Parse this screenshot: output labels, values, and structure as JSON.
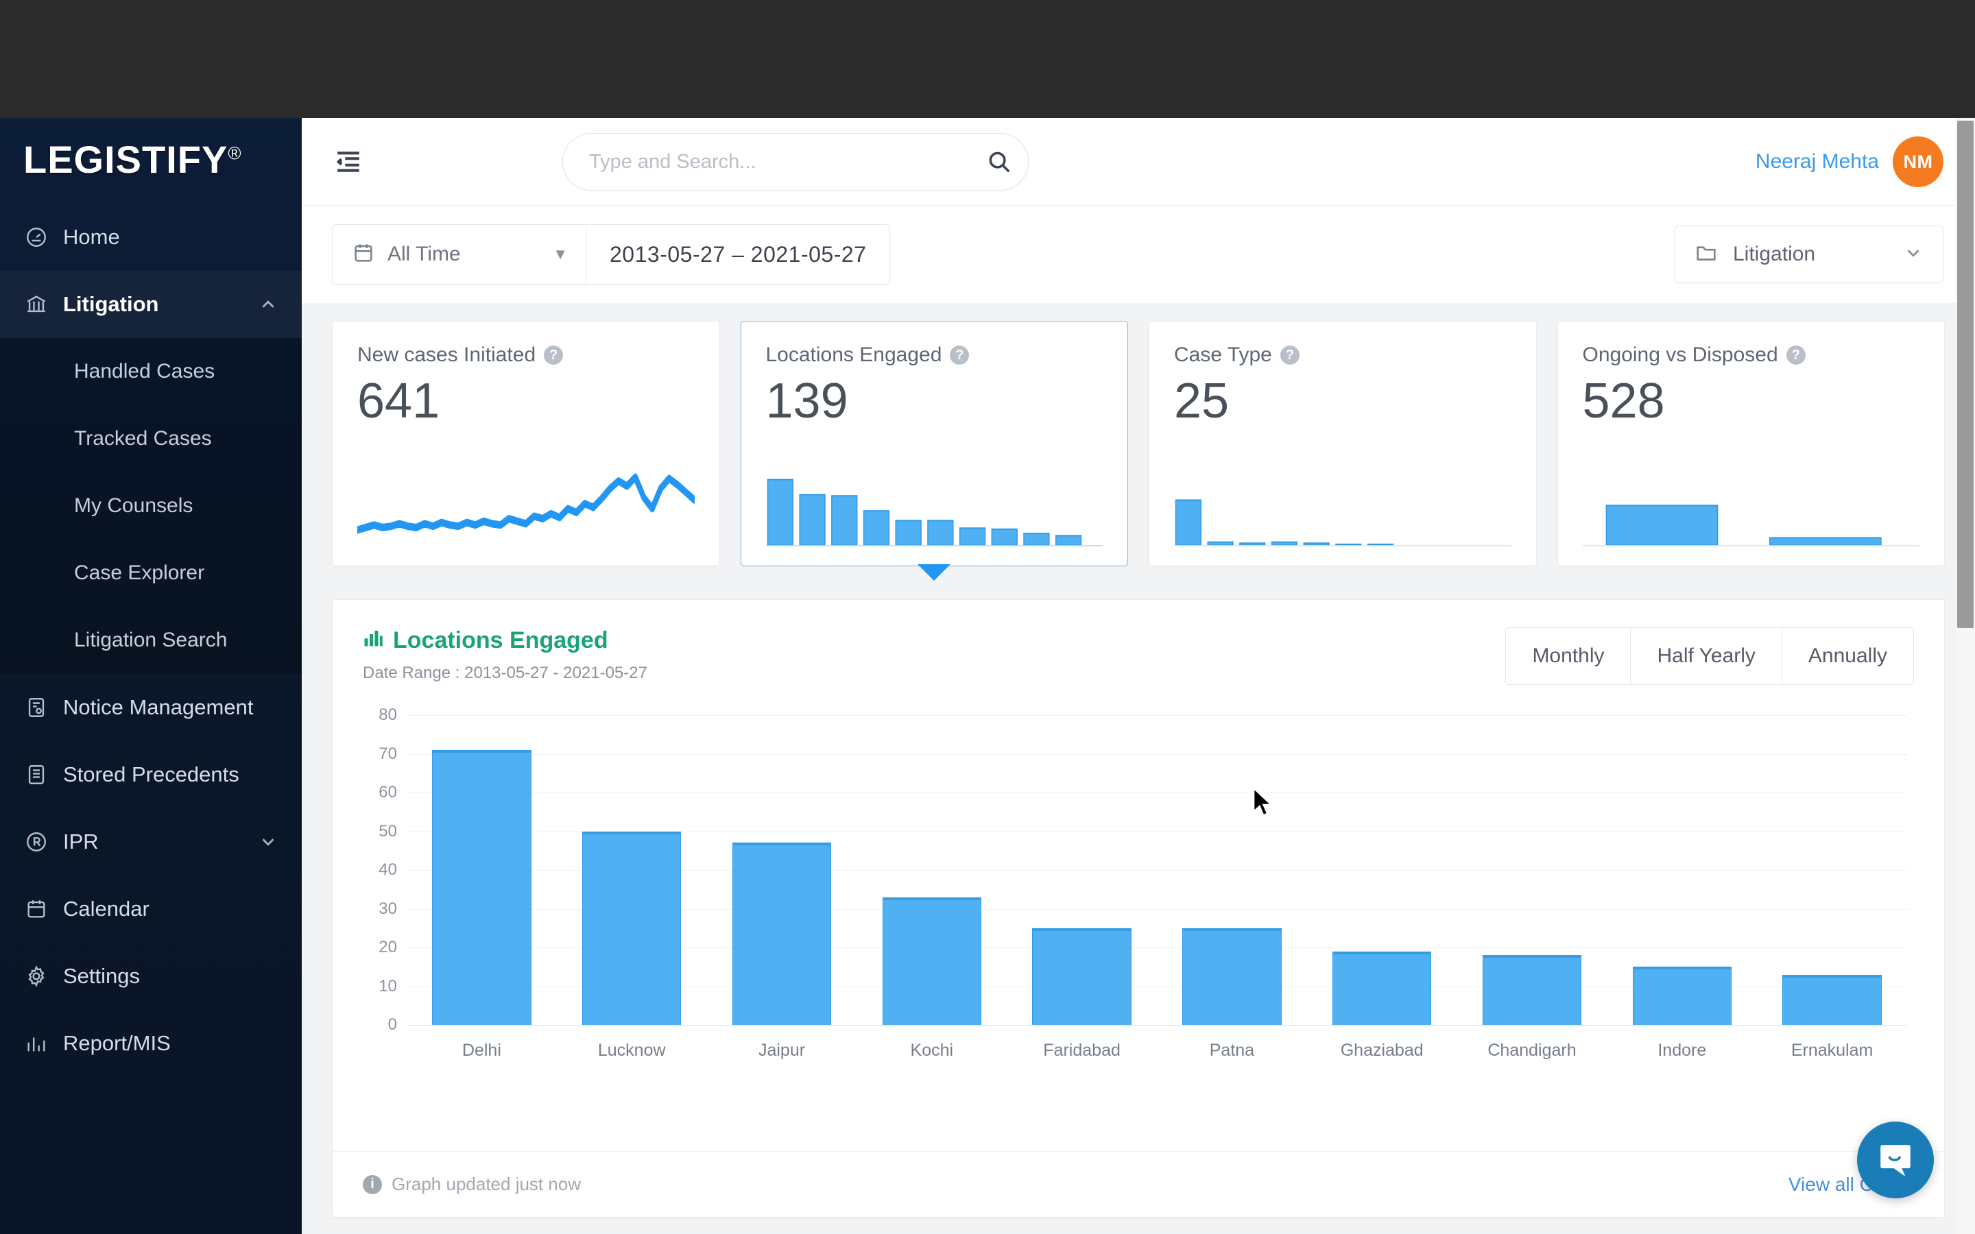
{
  "brand": {
    "name": "LEGISTIFY",
    "registered_mark": "®"
  },
  "sidebar": {
    "items": [
      {
        "label": "Home",
        "icon": "dashboard-icon"
      },
      {
        "label": "Litigation",
        "icon": "bank-icon",
        "caret": "chevron-up-icon",
        "active": true
      },
      {
        "label": "Notice Management",
        "icon": "notice-icon"
      },
      {
        "label": "Stored Precedents",
        "icon": "document-icon"
      },
      {
        "label": "IPR",
        "icon": "registered-icon",
        "caret": "chevron-down-icon"
      },
      {
        "label": "Calendar",
        "icon": "calendar-icon"
      },
      {
        "label": "Settings",
        "icon": "gear-icon"
      },
      {
        "label": "Report/MIS",
        "icon": "chart-icon"
      }
    ],
    "submenu": [
      {
        "label": "Handled Cases"
      },
      {
        "label": "Tracked Cases"
      },
      {
        "label": "My Counsels"
      },
      {
        "label": "Case Explorer"
      },
      {
        "label": "Litigation Search"
      }
    ]
  },
  "header": {
    "menu_toggle_icon": "menu-collapse-icon",
    "search": {
      "placeholder": "Type and Search...",
      "value": "",
      "icon": "search-icon"
    },
    "user": {
      "name": "Neeraj Mehta",
      "initials": "NM",
      "avatar_color": "#f47b20"
    }
  },
  "filters": {
    "date_preset": {
      "label": "All Time",
      "icon": "calendar-icon",
      "caret": "caret-down-icon"
    },
    "date_range": "2013-05-27  –  2021-05-27",
    "module": {
      "label": "Litigation",
      "icon": "folder-icon",
      "caret": "chevron-down-icon"
    }
  },
  "kpi_cards": [
    {
      "title": "New cases Initiated",
      "value": "641",
      "help": "?",
      "spark": "line",
      "selected": false
    },
    {
      "title": "Locations Engaged",
      "value": "139",
      "help": "?",
      "spark": "bars",
      "selected": true
    },
    {
      "title": "Case Type",
      "value": "25",
      "help": "?",
      "spark": "single",
      "selected": false
    },
    {
      "title": "Ongoing vs Disposed",
      "value": "528",
      "help": "?",
      "spark": "pair",
      "selected": false
    }
  ],
  "chart_panel": {
    "title": "Locations Engaged",
    "title_icon": "bar-chart-icon",
    "title_color": "#1aa37a",
    "subtitle": "Date Range : 2013-05-27 - 2021-05-27",
    "range_tabs": [
      {
        "label": "Monthly"
      },
      {
        "label": "Half Yearly"
      },
      {
        "label": "Annually"
      }
    ],
    "footer": {
      "updated_text": "Graph updated just now",
      "info_icon": "info-icon",
      "view_all_label": "View all Cases"
    }
  },
  "chart_data": {
    "type": "bar",
    "title": "Locations Engaged",
    "xlabel": "",
    "ylabel": "",
    "ylim": [
      0,
      80
    ],
    "yticks": [
      0,
      10,
      20,
      30,
      40,
      50,
      60,
      70,
      80
    ],
    "grid": true,
    "legend": "none",
    "bar_color": "#4fb0f2",
    "categories": [
      "Delhi",
      "Lucknow",
      "Jaipur",
      "Kochi",
      "Faridabad",
      "Patna",
      "Ghaziabad",
      "Chandigarh",
      "Indore",
      "Ernakulam"
    ],
    "values": [
      71,
      50,
      47,
      33,
      25,
      25,
      19,
      18,
      15,
      13
    ]
  },
  "sparkline_data": {
    "new_cases_line": [
      6,
      7,
      6,
      8,
      7,
      9,
      8,
      7,
      9,
      8,
      10,
      9,
      8,
      10,
      9,
      11,
      10,
      9,
      12,
      11,
      10,
      13,
      12,
      14,
      13,
      16,
      15,
      18,
      17,
      20,
      24,
      28,
      26,
      30,
      22,
      18,
      26,
      30,
      27,
      24,
      20
    ],
    "locations_bars": [
      62,
      44,
      46,
      30,
      22,
      22,
      16,
      14,
      11,
      9
    ],
    "case_type_bars": [
      60,
      3,
      2,
      3,
      2,
      1,
      1
    ],
    "ongoing_disposed": [
      70,
      10
    ]
  },
  "chat": {
    "icon": "chat-bubble-icon",
    "color": "#1a7db8"
  },
  "scrollbar": {
    "present": true
  }
}
